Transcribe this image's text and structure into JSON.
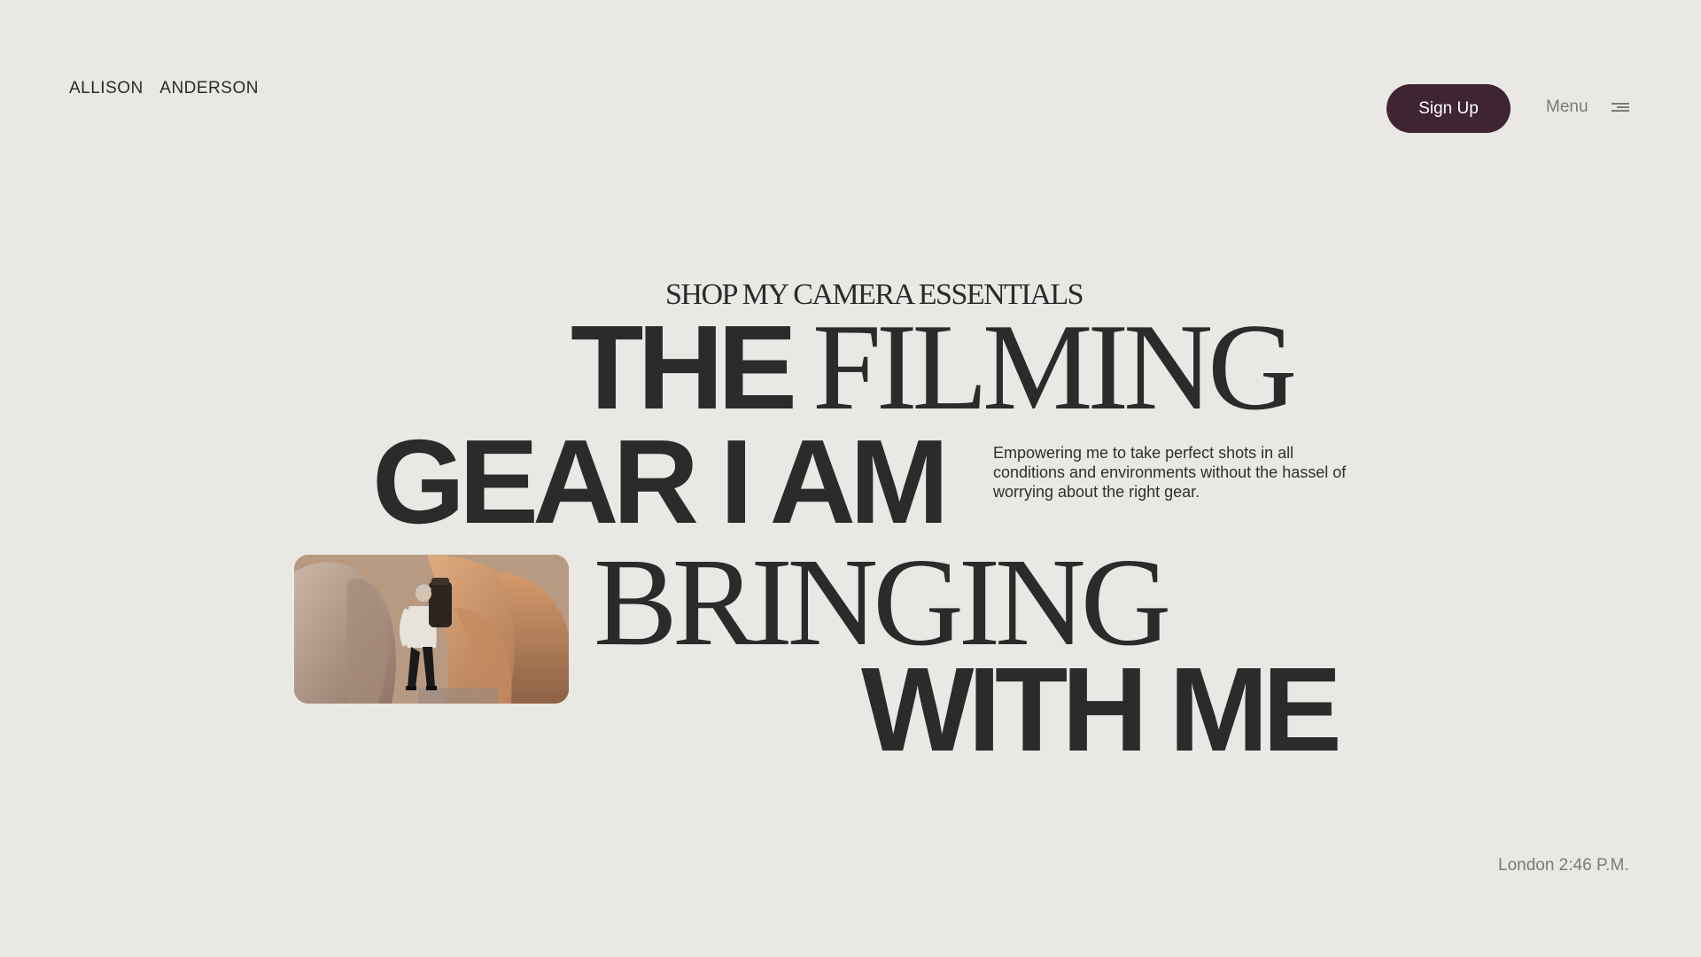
{
  "brand": {
    "name": "ALLISON  ANDERSON"
  },
  "header": {
    "signup_label": "Sign Up",
    "menu_label": "Menu",
    "menu_icon": "hamburger-menu-icon"
  },
  "hero": {
    "kicker": "SHOP MY CAMERA ESSENTIALS",
    "line1_bold": "THE",
    "line1_thin": "FILMING",
    "line2_bold": "GEAR I AM",
    "line3_thin": "BRINGING",
    "line4_bold": "WITH ME",
    "blurb": "Empowering me to take perfect shots in all conditions and environments without the hassel of worrying about the right gear.",
    "photo_subject": "hiker-with-camera-backpack-among-rocks"
  },
  "footer": {
    "clock": "London 2:46 P.M."
  },
  "colors": {
    "background": "#eae8e4",
    "text": "#2b2b2b",
    "accent": "#3f2432",
    "muted": "#7a7a7a"
  }
}
